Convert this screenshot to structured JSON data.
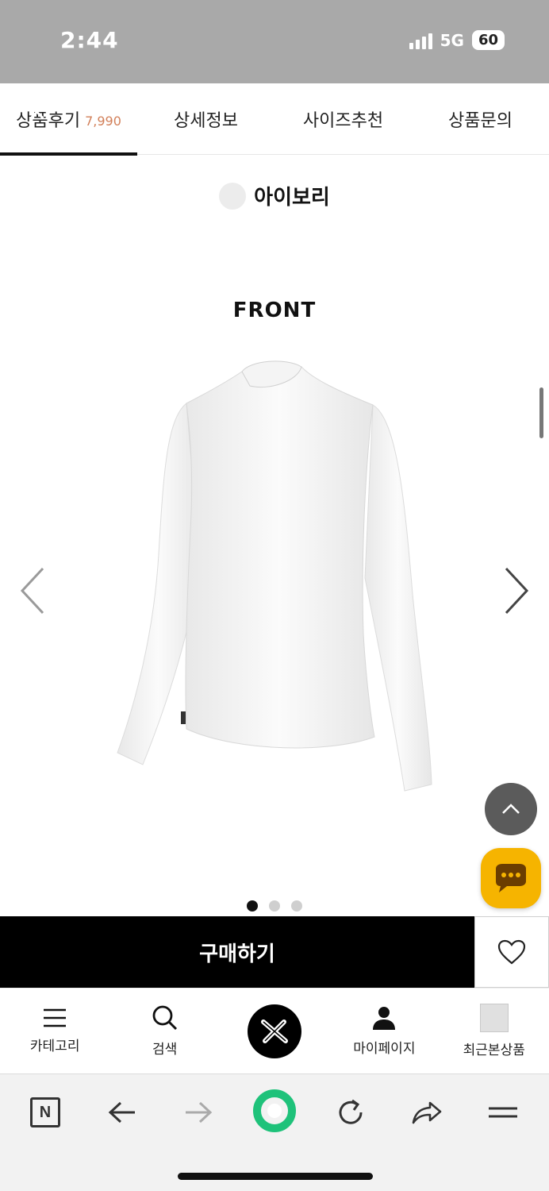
{
  "status": {
    "time": "2:44",
    "network": "5G",
    "battery": "60"
  },
  "tabs": [
    {
      "label": "상품후기",
      "count": "7,990",
      "active": true
    },
    {
      "label": "상세정보"
    },
    {
      "label": "사이즈추천"
    },
    {
      "label": "상품문의"
    }
  ],
  "color_option": {
    "name": "아이보리",
    "swatch": "#ececec"
  },
  "view_label": "FRONT",
  "carousel": {
    "total": 3,
    "current": 1
  },
  "buy": {
    "label": "구매하기"
  },
  "bottom_nav": [
    {
      "label": "카테고리",
      "icon": "menu-icon"
    },
    {
      "label": "검색",
      "icon": "search-icon"
    },
    {
      "label": "",
      "icon": "brand-logo-icon"
    },
    {
      "label": "마이페이지",
      "icon": "user-icon"
    },
    {
      "label": "최근본상품",
      "icon": "recent-thumbnail"
    }
  ],
  "colors": {
    "accent": "#f6b400",
    "count": "#d2805a",
    "primary": "#000000"
  }
}
